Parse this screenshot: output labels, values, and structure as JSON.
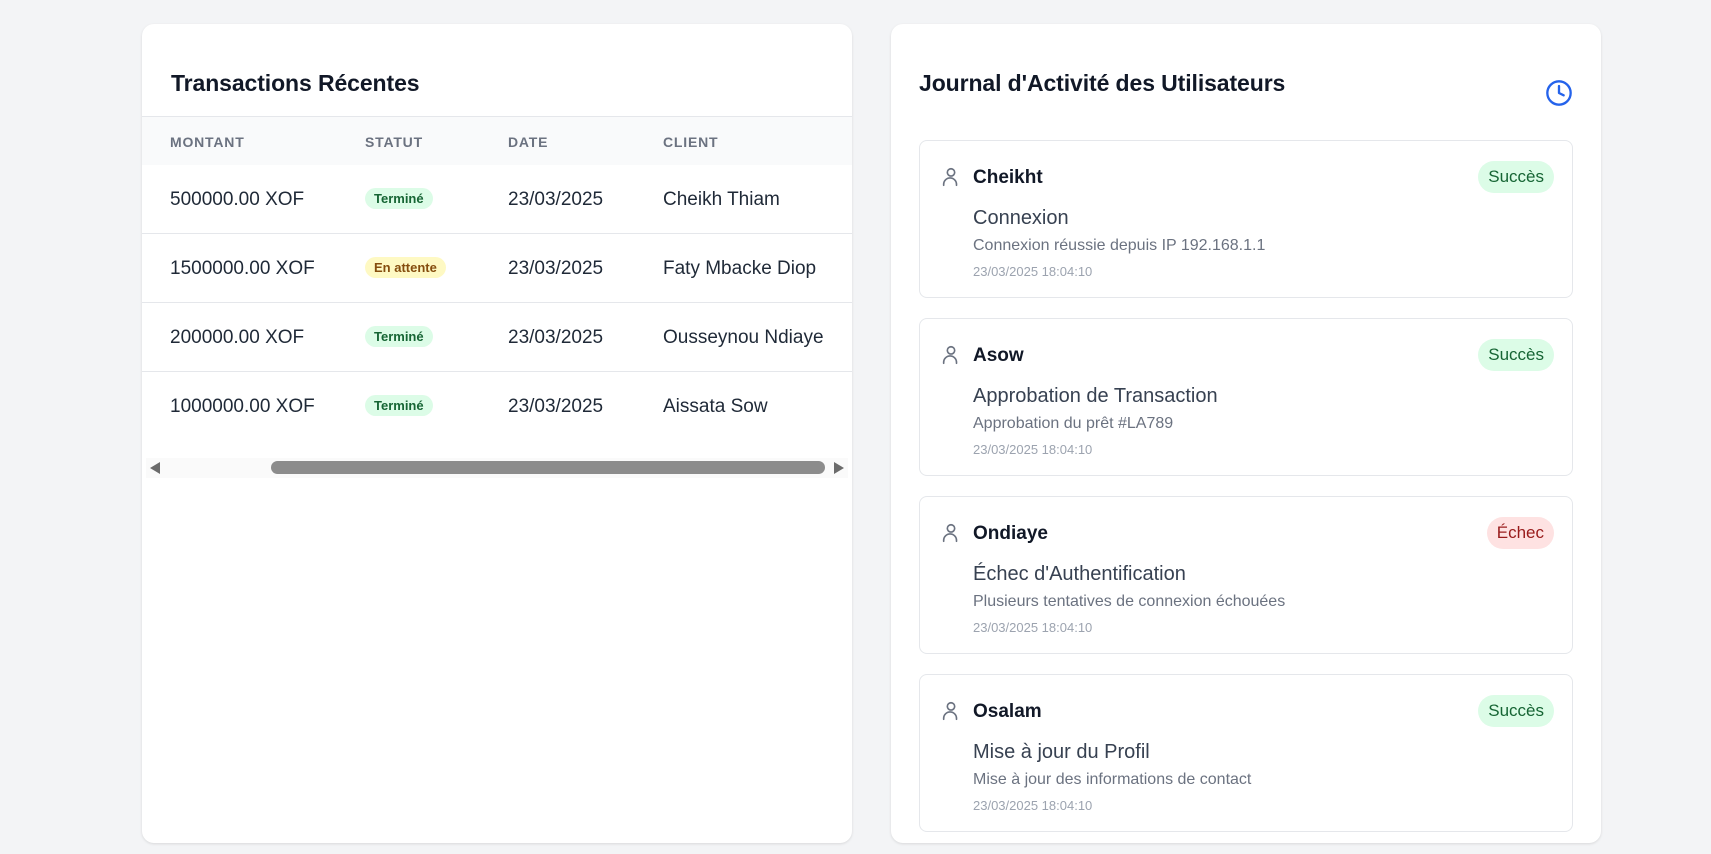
{
  "transactions": {
    "title": "Transactions Récentes",
    "columns": [
      "MONTANT",
      "STATUT",
      "DATE",
      "CLIENT"
    ],
    "rows": [
      {
        "amount": "500000.00 XOF",
        "status": "Terminé",
        "status_kind": "success",
        "date": "23/03/2025",
        "client": "Cheikh Thiam"
      },
      {
        "amount": "1500000.00 XOF",
        "status": "En attente",
        "status_kind": "pending",
        "date": "23/03/2025",
        "client": "Faty Mbacke Diop"
      },
      {
        "amount": "200000.00 XOF",
        "status": "Terminé",
        "status_kind": "success",
        "date": "23/03/2025",
        "client": "Ousseynou Ndiaye"
      },
      {
        "amount": "1000000.00 XOF",
        "status": "Terminé",
        "status_kind": "success",
        "date": "23/03/2025",
        "client": "Aissata Sow"
      }
    ]
  },
  "activity": {
    "title": "Journal d'Activité des Utilisateurs",
    "header_icon": "clock-icon",
    "entries": [
      {
        "user": "Cheikht",
        "status": "Succès",
        "status_kind": "success",
        "action": "Connexion",
        "detail": "Connexion réussie depuis IP 192.168.1.1",
        "time": "23/03/2025 18:04:10"
      },
      {
        "user": "Asow",
        "status": "Succès",
        "status_kind": "success",
        "action": "Approbation de Transaction",
        "detail": "Approbation du prêt #LA789",
        "time": "23/03/2025 18:04:10"
      },
      {
        "user": "Ondiaye",
        "status": "Échec",
        "status_kind": "failure",
        "action": "Échec d'Authentification",
        "detail": "Plusieurs tentatives de connexion échouées",
        "time": "23/03/2025 18:04:10"
      },
      {
        "user": "Osalam",
        "status": "Succès",
        "status_kind": "success",
        "action": "Mise à jour du Profil",
        "detail": "Mise à jour des informations de contact",
        "time": "23/03/2025 18:04:10"
      }
    ]
  },
  "colors": {
    "accent": "#2563eb",
    "success_bg": "#dcfce7",
    "success_text": "#166534",
    "pending_bg": "#fef9c3",
    "pending_text": "#854d0e",
    "failure_bg": "#fee2e2",
    "failure_text": "#991b1b"
  }
}
